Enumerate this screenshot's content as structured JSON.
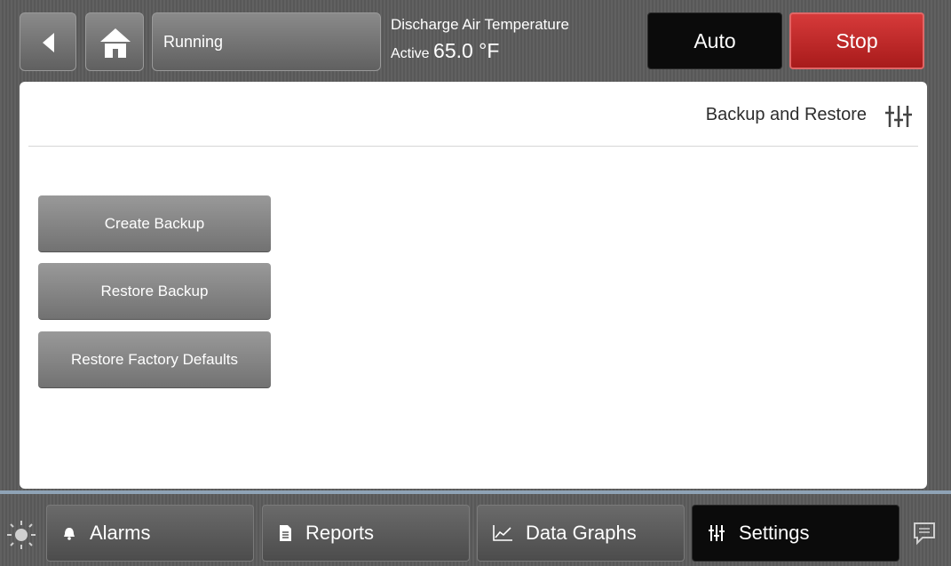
{
  "header": {
    "status": "Running",
    "sensor": {
      "title": "Discharge Air Temperature",
      "mode": "Active",
      "value": "65.0 °F"
    },
    "auto_label": "Auto",
    "stop_label": "Stop"
  },
  "page": {
    "title": "Backup and Restore"
  },
  "actions": [
    {
      "label": "Create Backup"
    },
    {
      "label": "Restore Backup"
    },
    {
      "label": "Restore Factory Defaults"
    }
  ],
  "tabs": [
    {
      "label": "Alarms",
      "icon": "bell-icon"
    },
    {
      "label": "Reports",
      "icon": "document-icon"
    },
    {
      "label": "Data Graphs",
      "icon": "chart-icon"
    },
    {
      "label": "Settings",
      "icon": "sliders-icon",
      "active": true
    }
  ],
  "colors": {
    "stop": "#c62828",
    "auto": "#0b0b0b",
    "active_tab": "#0b0b0b"
  }
}
